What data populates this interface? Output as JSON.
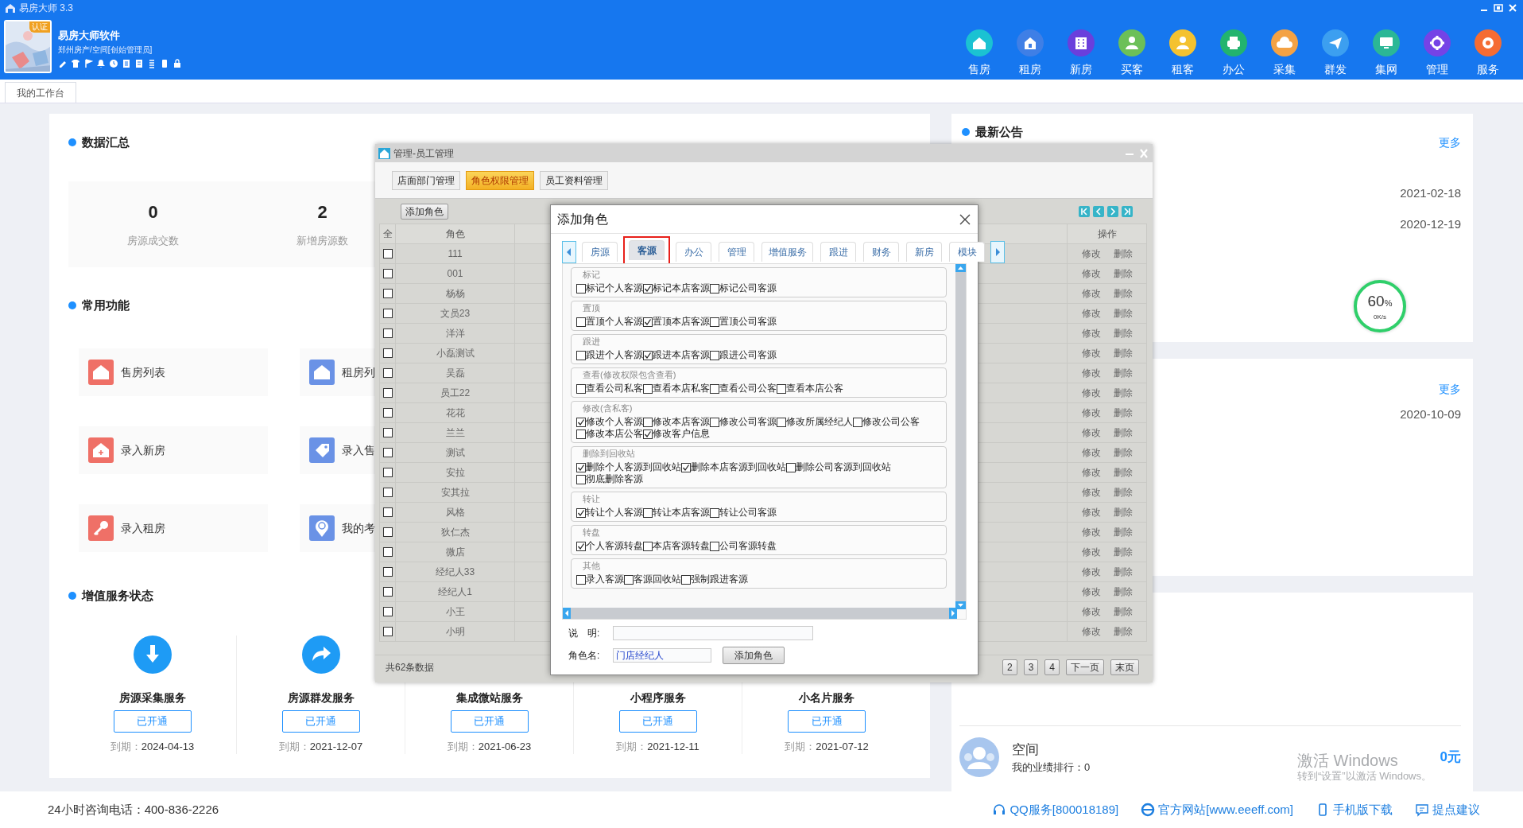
{
  "app_window": {
    "title": "易房大师 3.3"
  },
  "header": {
    "badge": "认证",
    "brand": "易房大师软件",
    "account": "郑州房产/空间[创始管理员]",
    "nav": [
      {
        "label": "售房",
        "color": "#1bc2d2"
      },
      {
        "label": "租房",
        "color": "#3f7fe6"
      },
      {
        "label": "新房",
        "color": "#6a3fdc"
      },
      {
        "label": "买客",
        "color": "#6cc058"
      },
      {
        "label": "租客",
        "color": "#f4c230"
      },
      {
        "label": "办公",
        "color": "#22b46e"
      },
      {
        "label": "采集",
        "color": "#f4a244"
      },
      {
        "label": "群发",
        "color": "#3c9ff0"
      },
      {
        "label": "集网",
        "color": "#2bb796"
      },
      {
        "label": "管理",
        "color": "#7543e6"
      },
      {
        "label": "服务",
        "color": "#f56c33"
      }
    ]
  },
  "page_tabs": [
    {
      "label": "我的工作台",
      "selected": true
    }
  ],
  "dashboard": {
    "summary": {
      "title": "数据汇总",
      "stats": [
        {
          "value": "0",
          "label": "房源成交数"
        },
        {
          "value": "2",
          "label": "新增房源数"
        }
      ]
    },
    "functions": {
      "title": "常用功能",
      "items": [
        {
          "label": "售房列表",
          "color": "#ef7067"
        },
        {
          "label": "租房列",
          "color": "#6a92e6"
        },
        {
          "label": "录入新房",
          "color": "#ef7067"
        },
        {
          "label": "录入售",
          "color": "#6a92e6"
        },
        {
          "label": "录入租房",
          "color": "#ef7067"
        },
        {
          "label": "我的考",
          "color": "#6a92e6"
        }
      ]
    },
    "services": {
      "title": "增值服务状态",
      "items": [
        {
          "name": "房源采集服务",
          "status": "已开通",
          "expiry_label": "到期：",
          "expiry": "2024-04-13",
          "icon_hidden": false
        },
        {
          "name": "房源群发服务",
          "status": "已开通",
          "expiry_label": "到期：",
          "expiry": "2021-12-07",
          "icon_hidden": false
        },
        {
          "name": "集成微站服务",
          "status": "已开通",
          "expiry_label": "到期：",
          "expiry": "2021-06-23",
          "icon_hidden": true
        },
        {
          "name": "小程序服务",
          "status": "已开通",
          "expiry_label": "到期：",
          "expiry": "2021-12-11",
          "icon_hidden": true
        },
        {
          "name": "小名片服务",
          "status": "已开通",
          "expiry_label": "到期：",
          "expiry": "2021-07-12",
          "icon_hidden": true
        }
      ]
    }
  },
  "notices": {
    "title": "最新公告",
    "more": "更多",
    "dates": [
      "2021-02-18",
      "2020-12-19"
    ]
  },
  "panel_2": {
    "more": "更多",
    "dates": [
      "2020-10-09"
    ]
  },
  "ranking": {
    "name": "空间",
    "rank_text": "我的业绩排行：0",
    "amount": "0元"
  },
  "footer": {
    "hotline": "24小时咨询电话：400-836-2226",
    "links": [
      "QQ服务[800018189]",
      "官方网站[www.eeeff.com]",
      "手机版下载",
      "提点建议"
    ]
  },
  "staff_window": {
    "title": "管理-员工管理",
    "tabs": [
      {
        "label": "店面部门管理",
        "selected": false
      },
      {
        "label": "角色权限管理",
        "selected": true
      },
      {
        "label": "员工资料管理",
        "selected": false
      }
    ],
    "add_button": "添加角色",
    "columns": [
      "全",
      "角色",
      "操作"
    ],
    "rows": [
      {
        "checked": false,
        "role": "111",
        "actions": [
          "修改",
          "删除"
        ]
      },
      {
        "checked": false,
        "role": "001",
        "actions": [
          "修改",
          "删除"
        ]
      },
      {
        "checked": false,
        "role": "杨杨",
        "actions": [
          "修改",
          "删除"
        ]
      },
      {
        "checked": false,
        "role": "文员23",
        "actions": [
          "修改",
          "删除"
        ]
      },
      {
        "checked": false,
        "role": "洋洋",
        "actions": [
          "修改",
          "删除"
        ]
      },
      {
        "checked": false,
        "role": "小磊测试",
        "actions": [
          "修改",
          "删除"
        ]
      },
      {
        "checked": false,
        "role": "吴磊",
        "actions": [
          "修改",
          "删除"
        ]
      },
      {
        "checked": false,
        "role": "员工22",
        "actions": [
          "修改",
          "删除"
        ]
      },
      {
        "checked": false,
        "role": "花花",
        "actions": [
          "修改",
          "删除"
        ]
      },
      {
        "checked": false,
        "role": "兰兰",
        "actions": [
          "修改",
          "删除"
        ]
      },
      {
        "checked": false,
        "role": "测试",
        "actions": [
          "修改",
          "删除"
        ]
      },
      {
        "checked": false,
        "role": "安拉",
        "actions": [
          "修改",
          "删除"
        ]
      },
      {
        "checked": false,
        "role": "安其拉",
        "actions": [
          "修改",
          "删除"
        ]
      },
      {
        "checked": false,
        "role": "风格",
        "actions": [
          "修改",
          "删除"
        ]
      },
      {
        "checked": false,
        "role": "狄仁杰",
        "actions": [
          "修改",
          "删除"
        ]
      },
      {
        "checked": false,
        "role": "微店",
        "actions": [
          "修改",
          "删除"
        ]
      },
      {
        "checked": false,
        "role": "经纪人33",
        "actions": [
          "修改",
          "删除"
        ]
      },
      {
        "checked": false,
        "role": "经纪人1",
        "actions": [
          "修改",
          "删除"
        ]
      },
      {
        "checked": false,
        "role": "小王",
        "actions": [
          "修改",
          "删除"
        ]
      },
      {
        "checked": false,
        "role": "小明",
        "actions": [
          "修改",
          "删除"
        ]
      }
    ],
    "total": "共62条数据",
    "pages": [
      "2",
      "3",
      "4",
      "下一页",
      "末页"
    ]
  },
  "role_dialog": {
    "title": "添加角色",
    "tabs": [
      {
        "label": "房源",
        "selected": false,
        "highlighted": false
      },
      {
        "label": "客源",
        "selected": true,
        "highlighted": true
      },
      {
        "label": "办公",
        "selected": false,
        "highlighted": false
      },
      {
        "label": "管理",
        "selected": false,
        "highlighted": false
      },
      {
        "label": "增值服务",
        "selected": false,
        "highlighted": false
      },
      {
        "label": "跟进",
        "selected": false,
        "highlighted": false
      },
      {
        "label": "财务",
        "selected": false,
        "highlighted": false
      },
      {
        "label": "新房",
        "selected": false,
        "highlighted": false
      },
      {
        "label": "模块",
        "selected": false,
        "highlighted": false
      }
    ],
    "groups": [
      {
        "legend": "标记",
        "options": [
          {
            "label": "标记个人客源",
            "checked": false
          },
          {
            "label": "标记本店客源",
            "checked": true
          },
          {
            "label": "标记公司客源",
            "checked": false
          }
        ]
      },
      {
        "legend": "置顶",
        "options": [
          {
            "label": "置顶个人客源",
            "checked": false
          },
          {
            "label": "置顶本店客源",
            "checked": true
          },
          {
            "label": "置顶公司客源",
            "checked": false
          }
        ]
      },
      {
        "legend": "跟进",
        "options": [
          {
            "label": "跟进个人客源",
            "checked": false
          },
          {
            "label": "跟进本店客源",
            "checked": true
          },
          {
            "label": "跟进公司客源",
            "checked": false
          }
        ]
      },
      {
        "legend": "查看(修改权限包含查看)",
        "options": [
          {
            "label": "查看公司私客",
            "checked": false
          },
          {
            "label": "查看本店私客",
            "checked": false
          },
          {
            "label": "查看公司公客",
            "checked": false
          },
          {
            "label": "查看本店公客",
            "checked": false
          }
        ]
      },
      {
        "legend": "修改(含私客)",
        "options": [
          {
            "label": "修改个人客源",
            "checked": true
          },
          {
            "label": "修改本店客源",
            "checked": false
          },
          {
            "label": "修改公司客源",
            "checked": false
          },
          {
            "label": "修改所属经纪人",
            "checked": false
          },
          {
            "label": "修改公司公客",
            "checked": false
          },
          {
            "label": "修改本店公客",
            "checked": false
          },
          {
            "label": "修改客户信息",
            "checked": true
          }
        ]
      },
      {
        "legend": "删除到回收站",
        "options": [
          {
            "label": "删除个人客源到回收站",
            "checked": true
          },
          {
            "label": "删除本店客源到回收站",
            "checked": true
          },
          {
            "label": "删除公司客源到回收站",
            "checked": false
          },
          {
            "label": "彻底删除客源",
            "checked": false
          }
        ]
      },
      {
        "legend": "转让",
        "options": [
          {
            "label": "转让个人客源",
            "checked": true
          },
          {
            "label": "转让本店客源",
            "checked": false
          },
          {
            "label": "转让公司客源",
            "checked": false
          }
        ]
      },
      {
        "legend": "转盘",
        "options": [
          {
            "label": "个人客源转盘",
            "checked": true
          },
          {
            "label": "本店客源转盘",
            "checked": false
          },
          {
            "label": "公司客源转盘",
            "checked": false
          }
        ]
      },
      {
        "legend": "其他",
        "options": [
          {
            "label": "录入客源",
            "checked": false
          },
          {
            "label": "客源回收站",
            "checked": false
          },
          {
            "label": "强制跟进客源",
            "checked": false
          }
        ]
      }
    ],
    "form": [
      {
        "label": "说　明:"
      },
      {
        "label": "角色名:",
        "value": "门店经纪人"
      }
    ],
    "submit": "添加角色"
  },
  "speed_widget": {
    "value": "60",
    "unit": "%",
    "rate": "0K/s"
  },
  "os_watermark": {
    "title": "激活 Windows",
    "hint": "转到“设置”以激活 Windows。"
  }
}
